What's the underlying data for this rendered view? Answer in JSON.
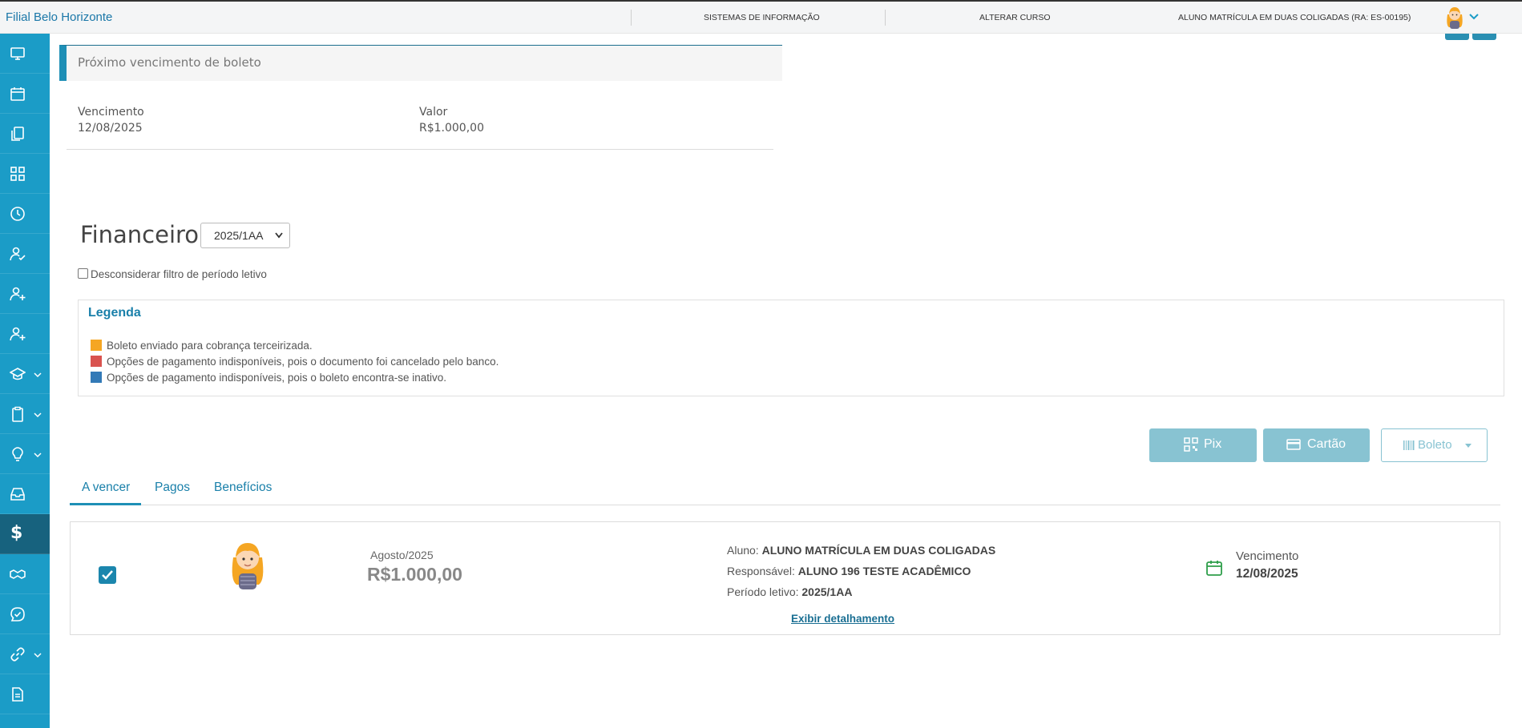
{
  "topbar": {
    "brand": "Filial Belo Horizonte",
    "items": [
      "SISTEMAS DE INFORMAÇÃO",
      "ALTERAR CURSO",
      "ALUNO MATRÍCULA EM DUAS COLIGADAS (RA: ES-00195)"
    ]
  },
  "sidebar": {
    "items": [
      {
        "icon": "monitor-icon"
      },
      {
        "icon": "calendar-icon"
      },
      {
        "icon": "documents-icon"
      },
      {
        "icon": "grid-icon"
      },
      {
        "icon": "clock-icon"
      },
      {
        "icon": "user-check-icon"
      },
      {
        "icon": "user-plus-icon"
      },
      {
        "icon": "user-plus-icon"
      },
      {
        "icon": "graduation-cap-icon",
        "expandable": true
      },
      {
        "icon": "clipboard-icon",
        "expandable": true
      },
      {
        "icon": "lightbulb-icon",
        "expandable": true
      },
      {
        "icon": "inbox-icon"
      },
      {
        "icon": "dollar-icon",
        "active": true
      },
      {
        "icon": "handshake-icon"
      },
      {
        "icon": "chat-check-icon"
      },
      {
        "icon": "link-icon",
        "expandable": true
      },
      {
        "icon": "document-icon"
      }
    ],
    "dollar_symbol": "$"
  },
  "next_due": {
    "title": "Próximo vencimento de boleto",
    "due_label": "Vencimento",
    "due_value": "12/08/2025",
    "amount_label": "Valor",
    "amount_value": "R$1.000,00"
  },
  "financeiro": {
    "title": "Financeiro:",
    "period_selected": "2025/1AA",
    "filter_label": "Desconsiderar filtro de período letivo"
  },
  "legend": {
    "title": "Legenda",
    "entries": [
      {
        "color": "#f5a623",
        "text": "Boleto enviado para cobrança terceirizada."
      },
      {
        "color": "#d9534f",
        "text": "Opções de pagamento indisponíveis, pois o documento foi cancelado pelo banco."
      },
      {
        "color": "#337ab7",
        "text": "Opções de pagamento indisponíveis, pois o boleto encontra-se inativo."
      }
    ]
  },
  "payment": {
    "pix": "Pix",
    "card": "Cartão",
    "boleto": "Boleto"
  },
  "tabs": [
    "A vencer",
    "Pagos",
    "Benefícios"
  ],
  "item": {
    "month": "Agosto/2025",
    "amount": "R$1.000,00",
    "student_label": "Aluno:",
    "student_value": "ALUNO MATRÍCULA EM DUAS COLIGADAS",
    "responsible_label": "Responsável:",
    "responsible_value": "ALUNO 196 TESTE ACADÊMICO",
    "period_label": "Período letivo:",
    "period_value": "2025/1AA",
    "detail_link": "Exibir detalhamento",
    "due_label": "Vencimento",
    "due_value": "12/08/2025"
  },
  "colors": {
    "sidebar": "#1b9cc7",
    "sidebar_active": "#17627e",
    "accent": "#1e8fb6",
    "pay_button": "#88c3d2",
    "calendar_icon": "#2e9e4a"
  }
}
